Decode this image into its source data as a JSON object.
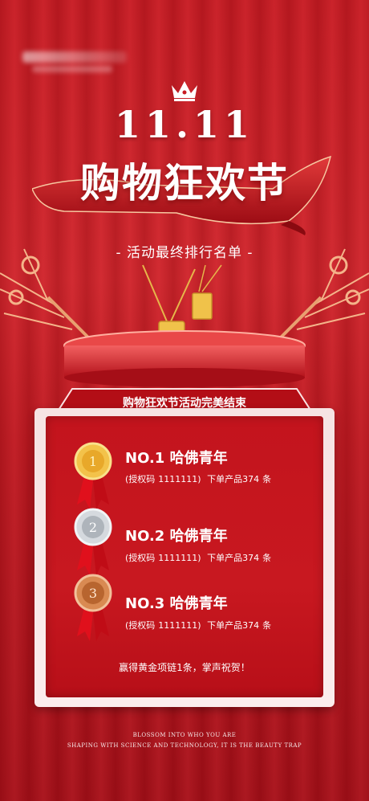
{
  "header": {
    "date": "11.11",
    "title": "购物狂欢节",
    "subtitle": "- 活动最终排行名单 -"
  },
  "banner": {
    "text": "购物狂欢节活动完美结束"
  },
  "ranks": [
    {
      "title": "NO.1 哈佛青年",
      "auth_label": "(授权码",
      "auth_code": "1111111)",
      "order_text": "下单产品374",
      "unit": "条",
      "medal": "gold-medal-icon"
    },
    {
      "title": "NO.2 哈佛青年",
      "auth_label": "(授权码",
      "auth_code": "1111111)",
      "order_text": "下单产品374",
      "unit": "条",
      "medal": "silver-medal-icon"
    },
    {
      "title": "NO.3 哈佛青年",
      "auth_label": "(授权码",
      "auth_code": "1111111)",
      "order_text": "下单产品374",
      "unit": "条",
      "medal": "bronze-medal-icon"
    }
  ],
  "prize_note": "赢得黄金项链1条，掌声祝贺！",
  "medal_numbers": [
    "1",
    "2",
    "3"
  ],
  "footer": {
    "line1": "BLOSSOM INTO WHO YOU ARE",
    "line2": "SHAPING WITH SCIENCE AND TECHNOLOGY, IT IS THE BEAUTY TRAP"
  },
  "colors": {
    "primary_red": "#c81a22",
    "panel_border": "#f6e3e3",
    "gold": "#e8b03a",
    "silver": "#c8ccd2",
    "bronze": "#c7743e"
  }
}
